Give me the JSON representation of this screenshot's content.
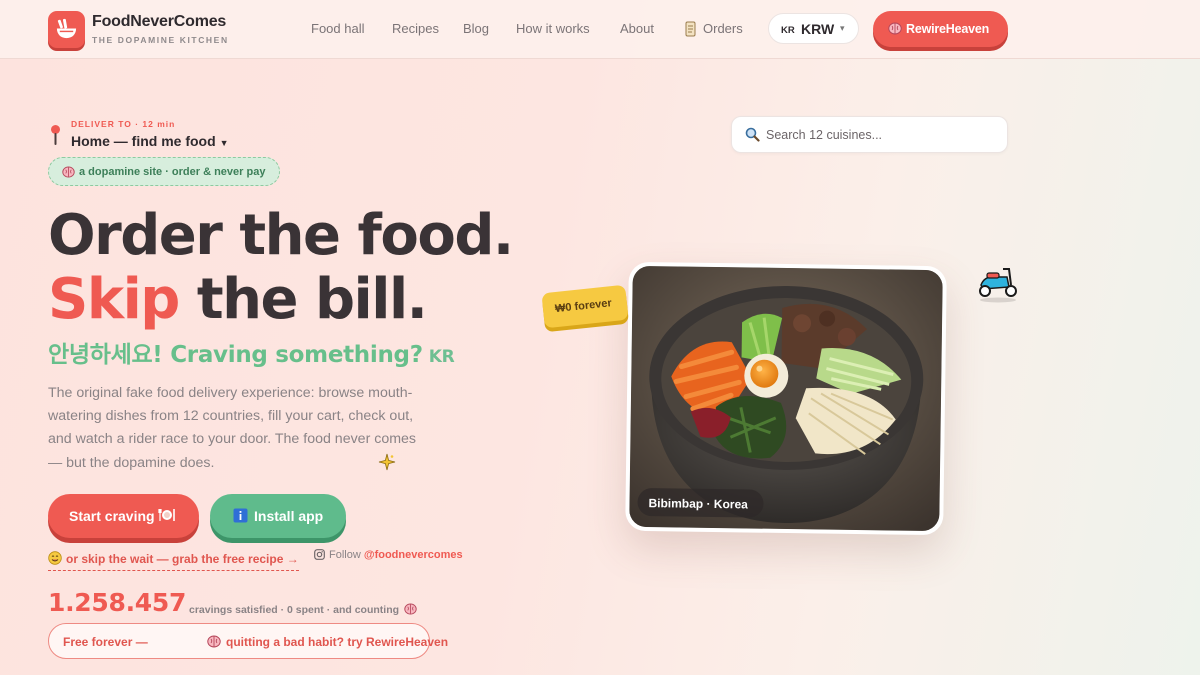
{
  "brand": {
    "name": "FoodNeverComes",
    "tagline": "THE DOPAMINE KITCHEN",
    "logo_icon": "ramen-bowl-icon"
  },
  "nav": {
    "items": [
      {
        "label": "Food hall"
      },
      {
        "label": "Recipes"
      },
      {
        "label": "Blog"
      },
      {
        "label": "How it works"
      },
      {
        "label": "About"
      },
      {
        "label": "Orders",
        "icon": "scroll-icon"
      }
    ],
    "currency": {
      "country": "KR",
      "code": "KRW"
    },
    "cta_label": "RewireHeaven"
  },
  "deliver": {
    "label": "DELIVER TO · 12 min",
    "value": "Home — find me food"
  },
  "badge": "a dopamine site · order & never pay",
  "search": {
    "placeholder": "Search 12 cuisines..."
  },
  "hero": {
    "line1": "Order the food.",
    "line2_accent": "Skip",
    "line2_rest": " the bill.",
    "greeting": "안녕하세요! Craving something?",
    "greeting_country": "KR",
    "description": "The original fake food delivery experience: browse mouth-watering dishes from 12 countries, fill your cart, check out, and watch a rider race to your door. The food never comes — but the dopamine does."
  },
  "buttons": {
    "start": "Start craving",
    "install": "Install app"
  },
  "skip_link": "or skip the wait — grab the free recipe →",
  "follow": {
    "prefix": "Follow",
    "handle": "@foodnevercomes"
  },
  "stats": {
    "count": "1.258.457",
    "label": "cravings satisfied · 0 spent · and counting"
  },
  "free_pill": {
    "lead": "Free forever —",
    "rest": "quitting a bad habit? try RewireHeaven"
  },
  "food_card": {
    "caption": "Bibimbap · Korea",
    "price_tag": "₩0 forever"
  },
  "colors": {
    "accent": "#ef5a52",
    "green": "#5fbb8c",
    "yellow": "#f6c941",
    "text": "#3a3336"
  }
}
